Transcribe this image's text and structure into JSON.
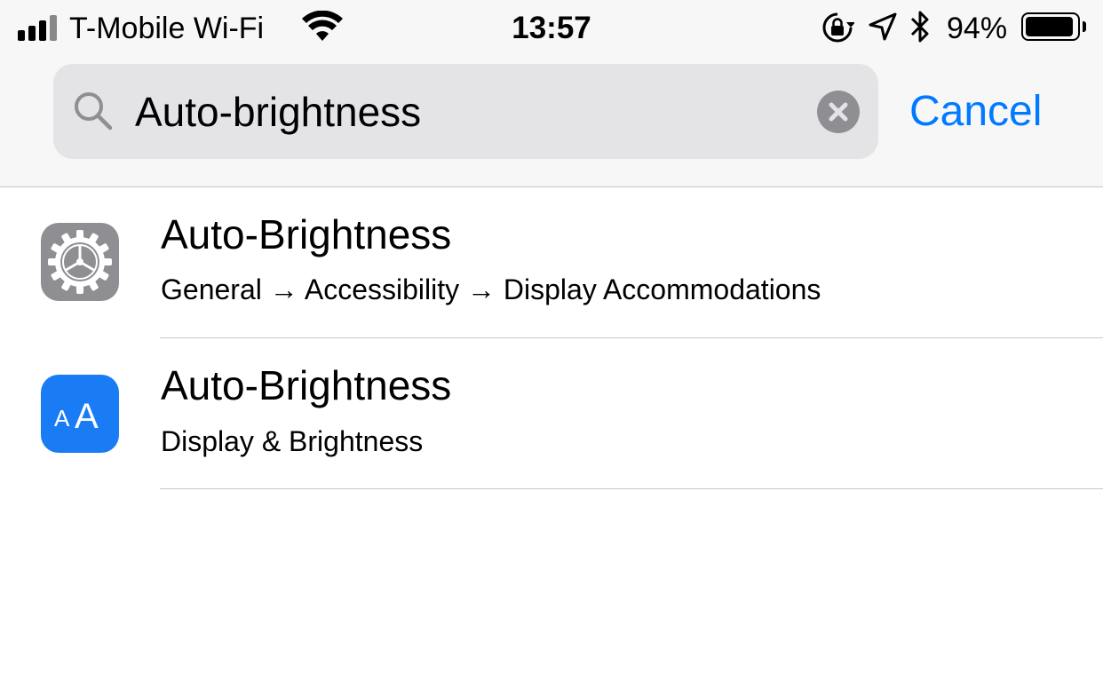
{
  "status_bar": {
    "carrier": "T-Mobile Wi-Fi",
    "time": "13:57",
    "battery_percent": "94%",
    "battery_level": 0.94,
    "signal_bars": 4,
    "icons": [
      "signal-icon",
      "wifi-icon",
      "rotation-lock-icon",
      "location-icon",
      "bluetooth-icon",
      "battery-icon"
    ]
  },
  "search": {
    "query": "Auto-brightness",
    "cancel_label": "Cancel"
  },
  "results": [
    {
      "title": "Auto-Brightness",
      "path": "General → Accessibility → Display Accommodations",
      "icon": "settings-gear-icon",
      "icon_color": "#8e8e93"
    },
    {
      "title": "Auto-Brightness",
      "path": "Display & Brightness",
      "icon": "display-brightness-icon",
      "icon_label": "AA",
      "icon_color": "#1a7cf5"
    }
  ],
  "colors": {
    "accent": "#007aff",
    "header_bg": "#f7f7f7",
    "search_field_bg": "#e4e4e7"
  }
}
